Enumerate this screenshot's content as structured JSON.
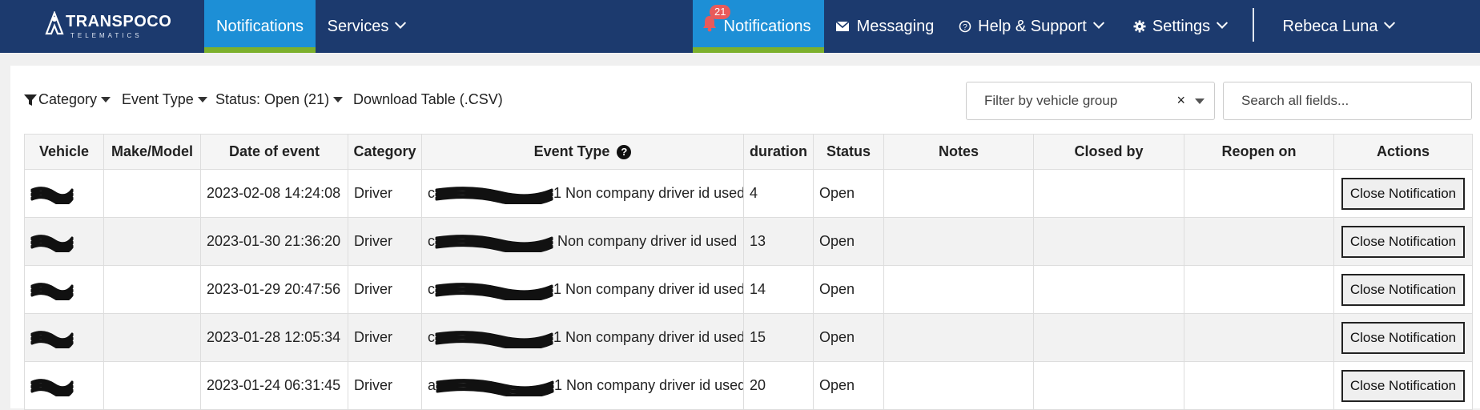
{
  "brand": {
    "name": "TRANSPOCO",
    "tagline": "TELEMATICS"
  },
  "nav": {
    "left": [
      {
        "label": "Notifications",
        "active": true
      },
      {
        "label": "Services",
        "dropdown": true
      }
    ],
    "right": {
      "notifications": {
        "label": "Notifications",
        "count": "21"
      },
      "messaging": "Messaging",
      "help": "Help & Support",
      "settings": "Settings",
      "user": "Rebeca Luna"
    }
  },
  "toolbar": {
    "category": "Category",
    "event_type": "Event Type",
    "status": "Status: Open (21)",
    "download": "Download Table (.CSV)",
    "vehicle_group_placeholder": "Filter by vehicle group",
    "clear": "×",
    "search_placeholder": "Search all fields..."
  },
  "table": {
    "headers": [
      "Vehicle",
      "Make/Model",
      "Date of event",
      "Category",
      "Event Type",
      "duration",
      "Status",
      "Notes",
      "Closed by",
      "Reopen on",
      "Actions"
    ],
    "rows": [
      {
        "date": "2023-02-08 14:24:08",
        "category": "Driver",
        "event_prefix": "c",
        "event_suffix": "1",
        "event": "Non company driver id used",
        "duration": "4",
        "status": "Open",
        "action": "Close Notification"
      },
      {
        "date": "2023-01-30 21:36:20",
        "category": "Driver",
        "event_prefix": "c",
        "event_suffix": "",
        "event": "Non company driver id used",
        "duration": "13",
        "status": "Open",
        "action": "Close Notification"
      },
      {
        "date": "2023-01-29 20:47:56",
        "category": "Driver",
        "event_prefix": "c",
        "event_suffix": "1",
        "event": "Non company driver id used",
        "duration": "14",
        "status": "Open",
        "action": "Close Notification"
      },
      {
        "date": "2023-01-28 12:05:34",
        "category": "Driver",
        "event_prefix": "c",
        "event_suffix": "1",
        "event": "Non company driver id used",
        "duration": "15",
        "status": "Open",
        "action": "Close Notification"
      },
      {
        "date": "2023-01-24 06:31:45",
        "category": "Driver",
        "event_prefix": "a",
        "event_suffix": "1",
        "event": "Non company driver id used",
        "duration": "20",
        "status": "Open",
        "action": "Close Notification"
      }
    ]
  },
  "colors": {
    "navbar": "#1c3a6e",
    "active_nav": "#1d8fd6",
    "active_underline": "#7cb02c",
    "badge": "#e85a5a"
  },
  "icons": {
    "bell": "bell-icon",
    "messaging": "envelope-icon",
    "help": "question-circle-icon",
    "settings": "gear-icon",
    "filter": "funnel-icon"
  }
}
